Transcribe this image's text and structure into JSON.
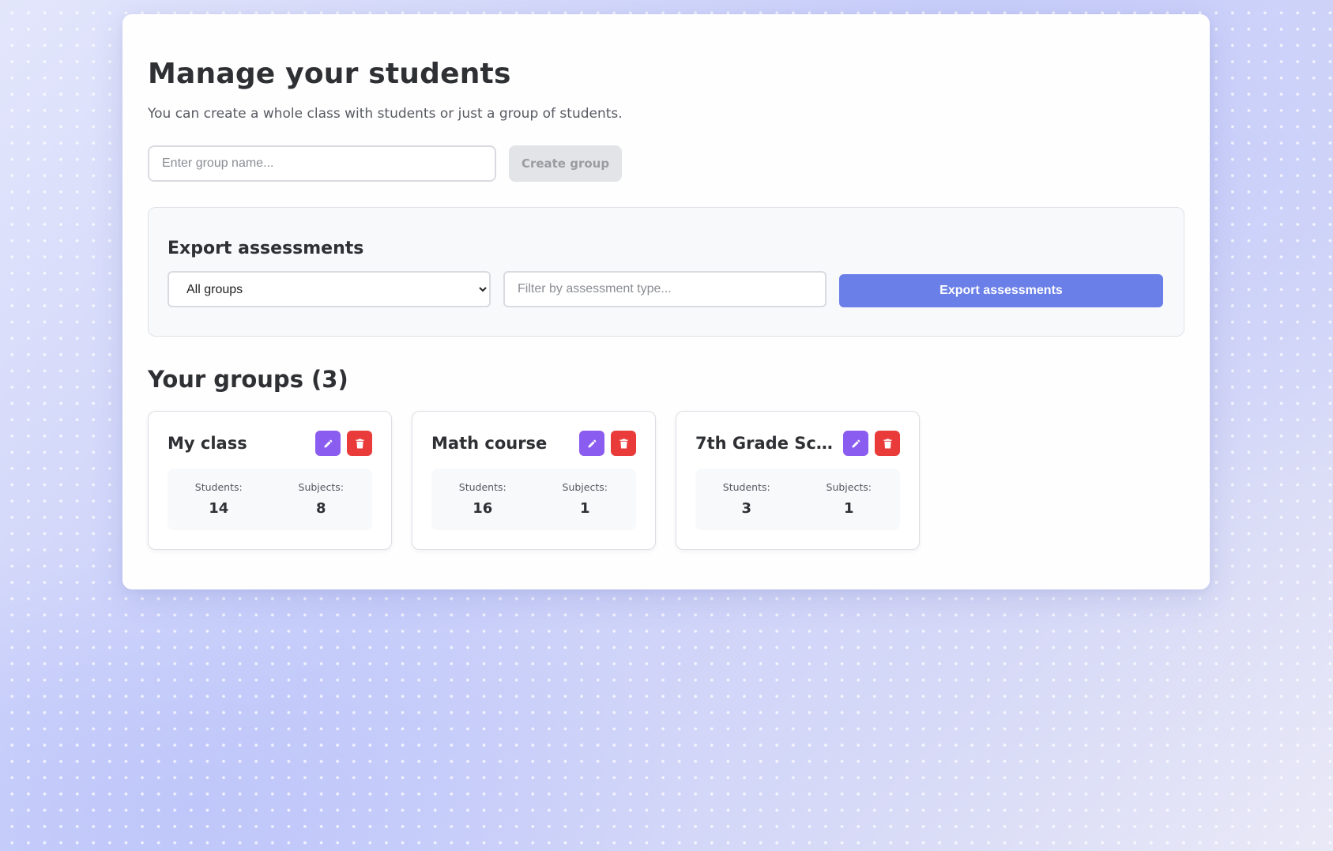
{
  "header": {
    "title": "Manage your students",
    "subtitle": "You can create a whole class with students or just a group of students."
  },
  "create_group": {
    "placeholder": "Enter group name...",
    "button_label": "Create group"
  },
  "export": {
    "title": "Export assessments",
    "group_select_value": "All groups",
    "filter_placeholder": "Filter by assessment type...",
    "button_label": "Export assessments"
  },
  "groups": {
    "title": "Your groups (3)",
    "students_label": "Students:",
    "subjects_label": "Subjects:",
    "items": [
      {
        "name": "My class",
        "students": "14",
        "subjects": "8"
      },
      {
        "name": "Math course",
        "students": "16",
        "subjects": "1"
      },
      {
        "name": "7th Grade Scie...",
        "students": "3",
        "subjects": "1"
      }
    ]
  },
  "icons": {
    "edit": "pencil-icon",
    "delete": "trash-icon"
  },
  "colors": {
    "accent": "#6a7fe8",
    "edit_button": "#8b5cf0",
    "delete_button": "#ea3b3b",
    "disabled_button": "#e2e4e8"
  }
}
